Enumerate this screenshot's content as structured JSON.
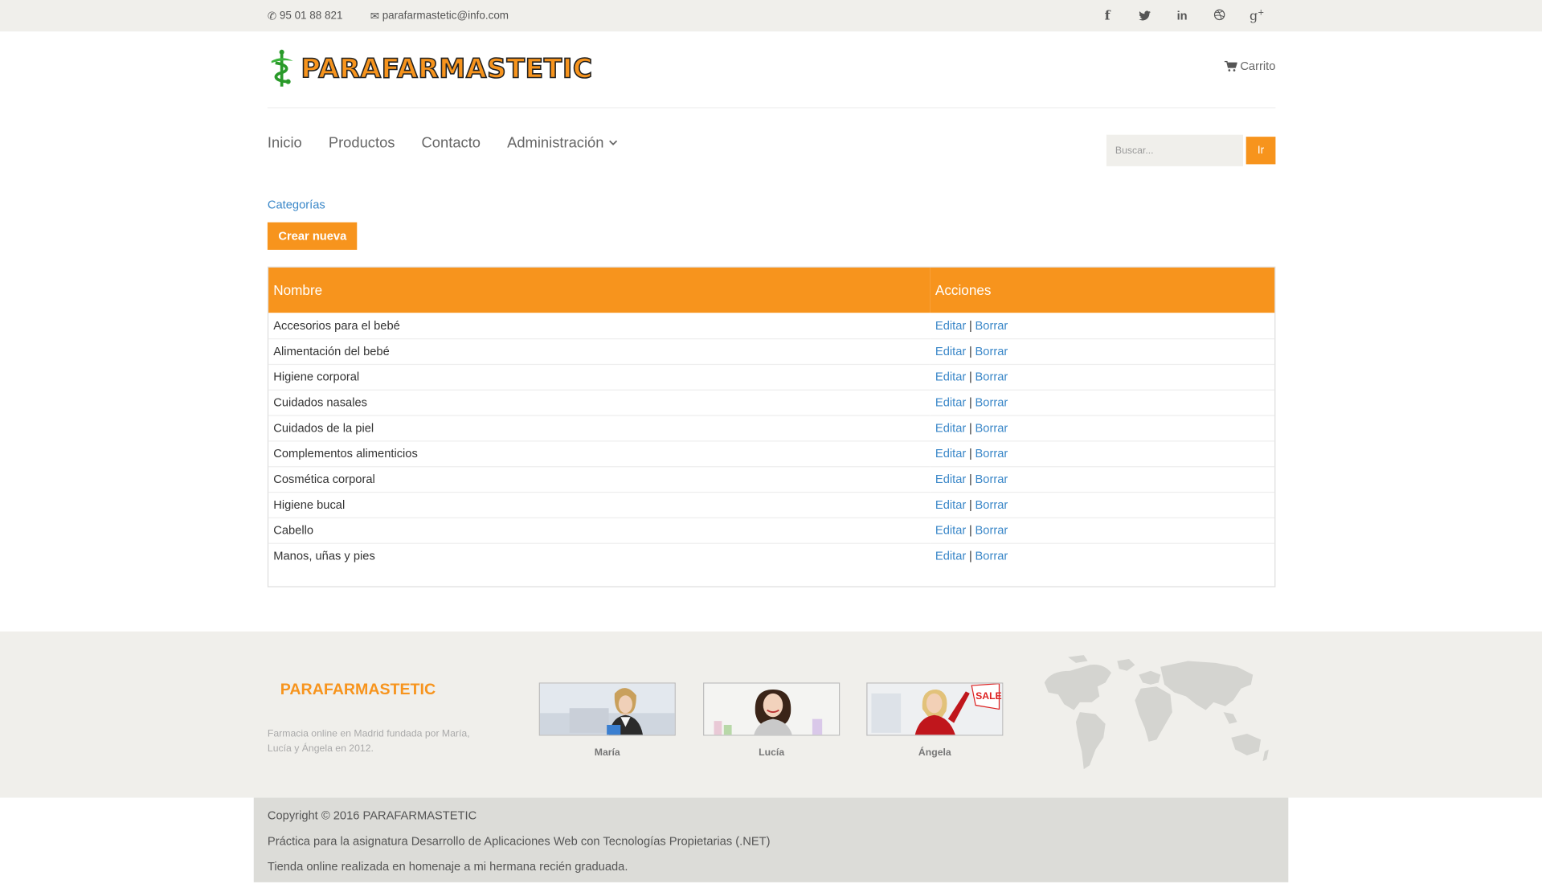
{
  "topbar": {
    "phone": "95 01 88 821",
    "email": "parafarmastetic@info.com",
    "social": [
      "facebook-icon",
      "twitter-icon",
      "linkedin-icon",
      "dribbble-icon",
      "google-plus-icon"
    ]
  },
  "header": {
    "logo_text": "PARAFARMASTETIC",
    "cart_label": "Carrito"
  },
  "nav": {
    "items": [
      "Inicio",
      "Productos",
      "Contacto",
      "Administración"
    ],
    "search_placeholder": "Buscar...",
    "search_button": "Ir"
  },
  "main": {
    "breadcrumb": "Categorías",
    "create_button": "Crear nueva",
    "table": {
      "headers": [
        "Nombre",
        "Acciones"
      ],
      "rows": [
        "Accesorios para el bebé",
        "Alimentación del bebé",
        "Higiene corporal",
        "Cuidados nasales",
        "Cuidados de la piel",
        "Complementos alimenticios",
        "Cosmética corporal",
        "Higiene bucal",
        "Cabello",
        "Manos, uñas y pies"
      ],
      "edit_label": "Editar",
      "separator": "|",
      "delete_label": "Borrar"
    }
  },
  "footer": {
    "brand": "PARAFARMASTETIC",
    "description": "Farmacia online en Madrid fundada por María, Lucía y Ángela en 2012.",
    "team": [
      "María",
      "Lucía",
      "Ángela"
    ]
  },
  "copyright": {
    "line1": "Copyright © 2016 PARAFARMASTETIC",
    "line2": "Práctica para la asignatura Desarrollo de Aplicaciones Web con Tecnologías Propietarias (.NET)",
    "line3": "Tienda online realizada en homenaje a mi hermana recién graduada."
  },
  "colors": {
    "accent": "#f7941d",
    "link": "#3a87c8",
    "topbar_bg": "#f0efeb"
  }
}
